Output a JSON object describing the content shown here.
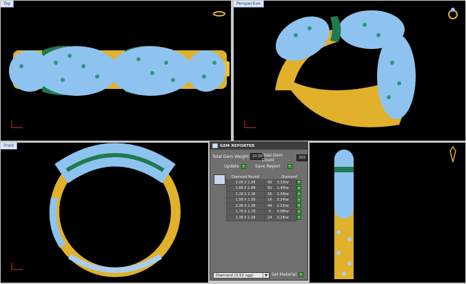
{
  "viewports": {
    "top": {
      "label": "Top"
    },
    "perspective": {
      "label": "Perspective"
    },
    "front": {
      "label": "Front"
    }
  },
  "gem_reporter": {
    "title": "GEM REPORTER",
    "total_weight_label": "Total Gem Weight",
    "total_weight_value": "10.09",
    "total_count_label": "Total Gem Count",
    "total_count_value": "303",
    "update_label": "Update",
    "save_report_label": "Save Report",
    "table": {
      "headers": [
        "Diamond Round",
        "Diamond"
      ],
      "rows": [
        {
          "size": "2.08 X 2.08",
          "count": "99",
          "weight": "3.33tw"
        },
        {
          "size": "1.88 X 1.88",
          "count": "60",
          "weight": "1.49tw"
        },
        {
          "size": "2.28 X 2.28",
          "count": "56",
          "weight": "2.49tw"
        },
        {
          "size": "1.58 X 1.58",
          "count": "16",
          "weight": "0.24tw"
        },
        {
          "size": "2.38 X 2.38",
          "count": "44",
          "weight": "2.22tw"
        },
        {
          "size": "1.78 X 1.78",
          "count": "4",
          "weight": "0.08tw"
        },
        {
          "size": "1.38 X 1.38",
          "count": "24",
          "weight": "0.24tw"
        }
      ]
    },
    "material_select": "Diamond   (3.52 sgg)",
    "set_material_label": "Set Material"
  },
  "colors": {
    "gem": "#8fc3ef",
    "gold": "#e1b12c",
    "setting": "#1f7a52",
    "viewport_bg": "#000000"
  }
}
